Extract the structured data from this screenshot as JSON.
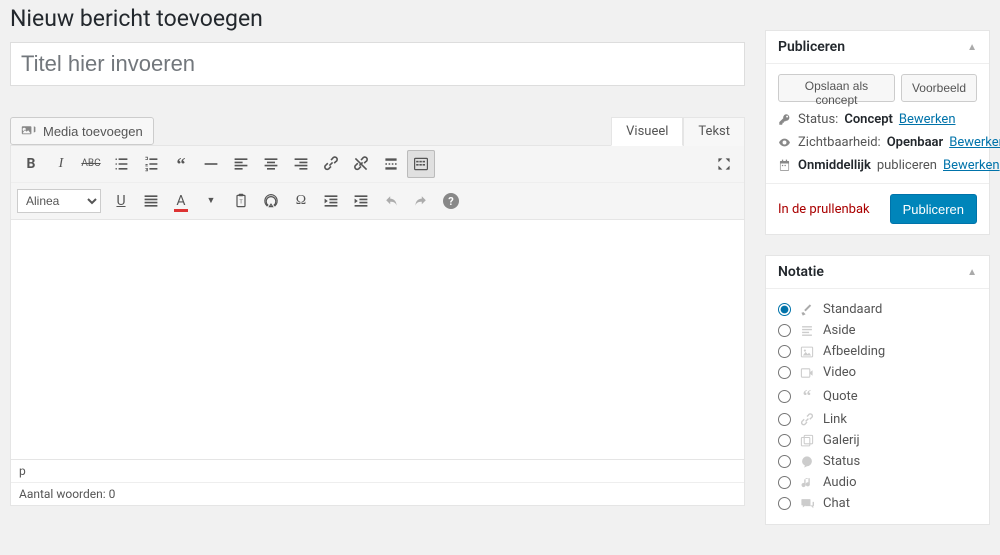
{
  "page_title": "Nieuw bericht toevoegen",
  "title_placeholder": "Titel hier invoeren",
  "media_button": "Media toevoegen",
  "tabs": {
    "visual": "Visueel",
    "text": "Tekst"
  },
  "format_select": "Alinea",
  "status_path": "p",
  "word_count_label": "Aantal woorden: 0",
  "publish": {
    "box_title": "Publiceren",
    "save_draft": "Opslaan als concept",
    "preview": "Voorbeeld",
    "status_label": "Status:",
    "status_value": "Concept",
    "edit": "Bewerken",
    "visibility_label": "Zichtbaarheid:",
    "visibility_value": "Openbaar",
    "schedule_strong": "Onmiddellijk",
    "schedule_rest": "publiceren",
    "trash": "In de prullenbak",
    "publish_btn": "Publiceren"
  },
  "format_box": {
    "title": "Notatie",
    "items": [
      {
        "key": "standard",
        "label": "Standaard",
        "checked": true
      },
      {
        "key": "aside",
        "label": "Aside",
        "checked": false
      },
      {
        "key": "image",
        "label": "Afbeelding",
        "checked": false
      },
      {
        "key": "video",
        "label": "Video",
        "checked": false
      },
      {
        "key": "quote",
        "label": "Quote",
        "checked": false
      },
      {
        "key": "link",
        "label": "Link",
        "checked": false
      },
      {
        "key": "gallery",
        "label": "Galerij",
        "checked": false
      },
      {
        "key": "status",
        "label": "Status",
        "checked": false
      },
      {
        "key": "audio",
        "label": "Audio",
        "checked": false
      },
      {
        "key": "chat",
        "label": "Chat",
        "checked": false
      }
    ]
  }
}
